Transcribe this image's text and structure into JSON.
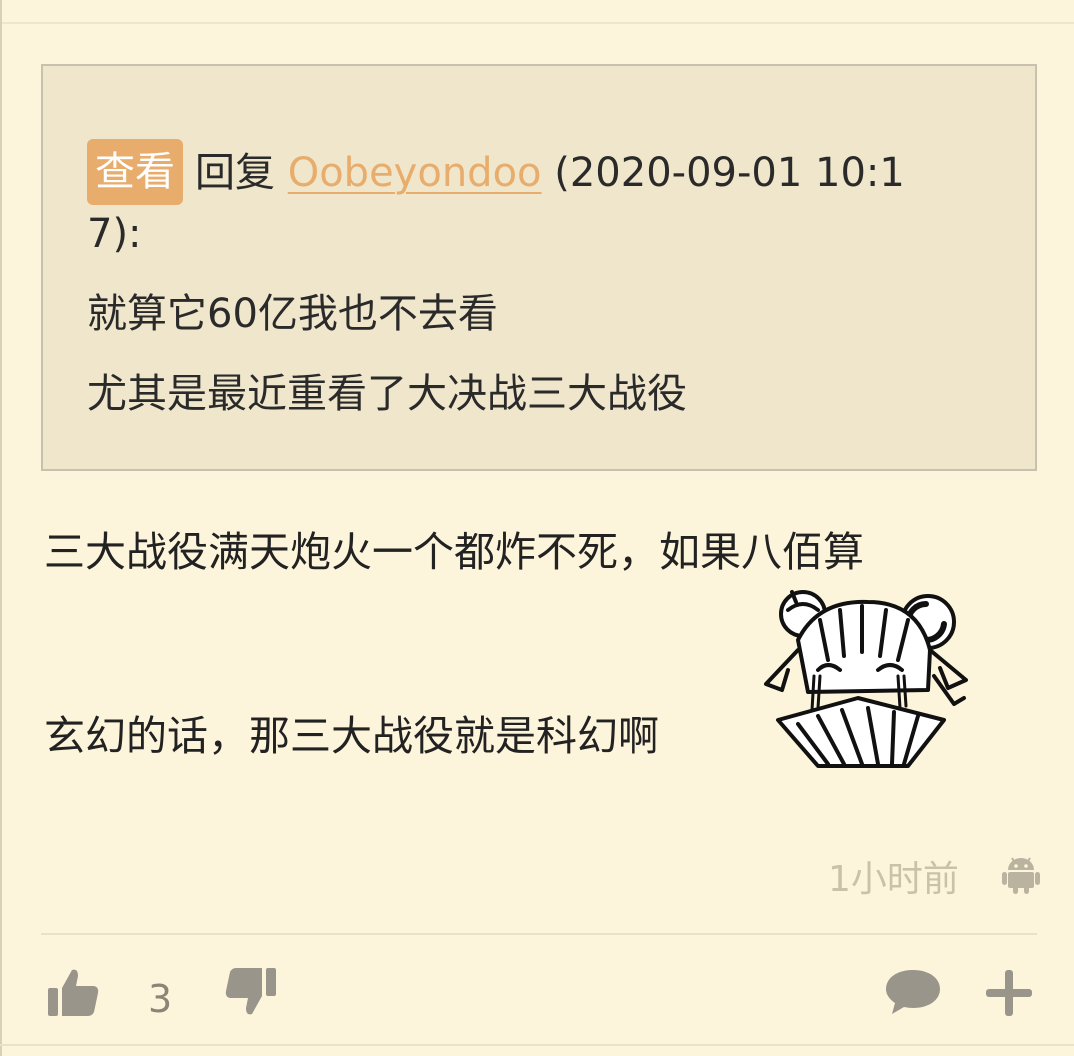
{
  "quote": {
    "view_button": "查看",
    "reply_prefix": "回复",
    "username": "Oobeyondoo",
    "timestamp_part1": "(2020-09-01 10:1",
    "timestamp_part2": "7):",
    "line1": "就算它60亿我也不去看",
    "line2": "尤其是最近重看了大决战三大战役"
  },
  "comment": {
    "line1": "三大战役满天炮火一个都炸不死，如果八佰算",
    "line2": "玄幻的话，那三大战役就是科幻啊"
  },
  "meta": {
    "time_ago": "1小时前",
    "device_icon": "android-icon"
  },
  "actions": {
    "like_icon": "thumbs-up-icon",
    "like_count": "3",
    "dislike_icon": "thumbs-down-icon",
    "comment_icon": "comment-bubble-icon",
    "more_icon": "plus-icon"
  },
  "colors": {
    "background": "#fdf5db",
    "quote_background": "#efe6cb",
    "accent": "#e8ad6c",
    "muted": "#c9c2ab",
    "icon": "#9a958a"
  }
}
